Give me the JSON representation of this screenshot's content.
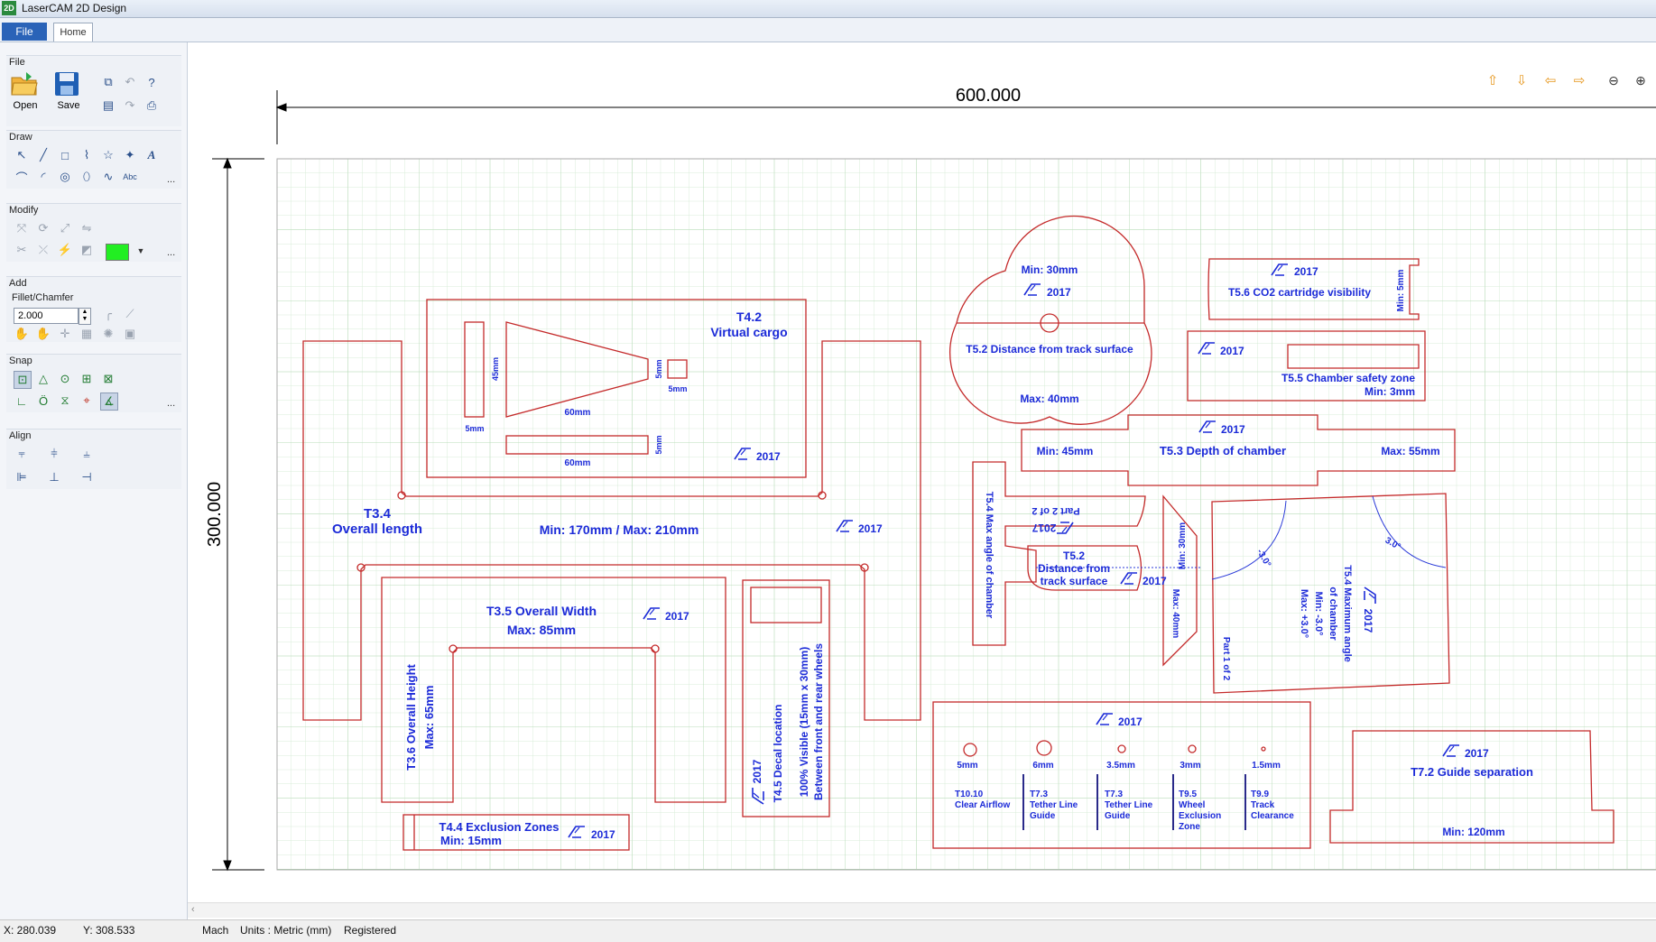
{
  "window": {
    "title": "LaserCAM 2D Design",
    "icon_text": "2D"
  },
  "tabs": {
    "file": "File",
    "home": "Home"
  },
  "ribbon": {
    "file_group": {
      "label": "File",
      "open": "Open",
      "save": "Save"
    },
    "draw_group": {
      "label": "Draw",
      "text_tool": "A",
      "abc_tool": "Abc"
    },
    "modify_group": {
      "label": "Modify",
      "color_swatch": "#22ee22"
    },
    "add_group": {
      "label": "Add"
    },
    "fillet_group": {
      "label": "Fillet/Chamfer",
      "value": "2.000"
    },
    "snap_group": {
      "label": "Snap"
    },
    "align_group": {
      "label": "Align"
    },
    "more": "..."
  },
  "canvas": {
    "dim_width": "600.000",
    "dim_height": "300.000",
    "year": "2017",
    "labels": {
      "t42_a": "T4.2",
      "t42_b": "Virtual cargo",
      "t34_a": "T3.4",
      "t34_b": "Overall length",
      "length_range": "Min: 170mm / Max: 210mm",
      "m45": "45mm",
      "m60a": "60mm",
      "m60b": "60mm",
      "m5a": "5mm",
      "m5b": "5mm",
      "m5c": "5mm",
      "m5d": "5mm",
      "t35_a": "T3.5 Overall Width",
      "t35_b": "Max: 85mm",
      "t36_a": "T3.6 Overall Height",
      "t36_b": "Max: 65mm",
      "t44_a": "T4.4 Exclusion Zones",
      "t44_b": "Min: 15mm",
      "t45_a": "T4.5 Decal location",
      "t45_b": "100% Visible (15mm x 30mm)",
      "t45_c": "Between front and rear wheels",
      "t52_min": "Min: 30mm",
      "t52_label": "T5.2 Distance from track surface",
      "t52_max": "Max: 40mm",
      "t56": "T5.6 CO2 cartridge visibility",
      "t56_min": "Min: 5mm",
      "t55_a": "T5.5 Chamber safety zone",
      "t55_b": "Min: 3mm",
      "t53_min": "Min: 45mm",
      "t53": "T5.3 Depth of chamber",
      "t53_max": "Max: 55mm",
      "t54_side": "T5.4 Max angle of chamber",
      "part2": "Part 2 of 2",
      "part1": "Part 1 of 2",
      "t52b_a": "T5.2",
      "t52b_b": "Distance from",
      "t52b_c": "track surface",
      "min30": "Min: 30mm",
      "max40": "Max: 40mm",
      "t54_a": "T5.4 Maximum angle",
      "t54_b": "of chamber",
      "t54_c": "Min: -3.0°",
      "t54_d": "Max: +3.0°",
      "angle_neg": "-3.0°",
      "angle_pos": "3.0°",
      "h5mm": "5mm",
      "h6mm": "6mm",
      "h35a": "3.5mm",
      "h3mm": "3mm",
      "h15": "1.5mm",
      "t1010_a": "T10.10",
      "t1010_b": "Clear Airflow",
      "t73a_a": "T7.3",
      "t73a_b": "Tether Line",
      "t73a_c": "Guide",
      "t73b_a": "T7.3",
      "t73b_b": "Tether Line",
      "t73b_c": "Guide",
      "t95_a": "T9.5",
      "t95_b": "Wheel",
      "t95_c": "Exclusion",
      "t95_d": "Zone",
      "t99_a": "T9.9",
      "t99_b": "Track",
      "t99_c": "Clearance",
      "t72": "T7.2 Guide separation",
      "t72_min": "Min: 120mm"
    }
  },
  "status": {
    "x": "X: 280.039",
    "y": "Y: 308.533",
    "mode": "Mach",
    "units": "Units : Metric (mm)",
    "reg": "Registered"
  }
}
